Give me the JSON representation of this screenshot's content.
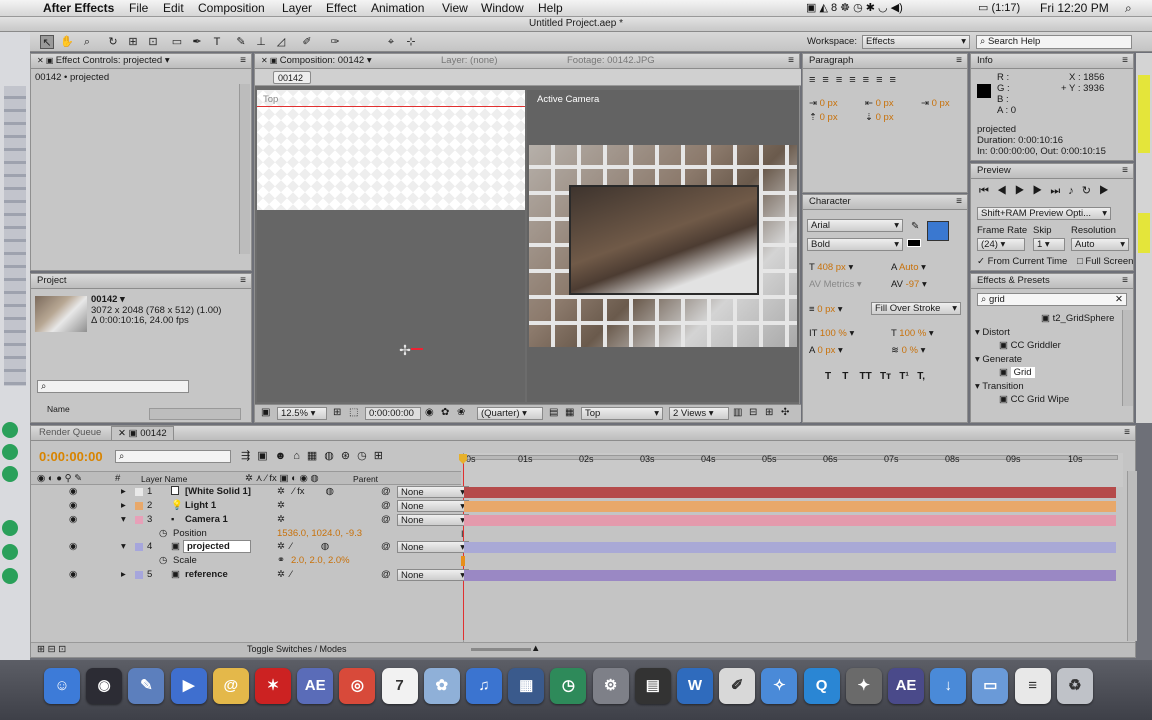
{
  "menubar": {
    "app": "After Effects",
    "items": [
      "File",
      "Edit",
      "Composition",
      "Layer",
      "Effect",
      "Animation",
      "View",
      "Window",
      "Help"
    ],
    "status_items": [
      "8",
      "(1:17)",
      "Fri 12:20 PM"
    ]
  },
  "title": "Untitled Project.aep *",
  "workspace": {
    "label": "Workspace:",
    "value": "Effects"
  },
  "search_help": {
    "placeholder": "Search Help"
  },
  "effect_controls": {
    "tab": "Effect Controls: projected",
    "subtitle": "00142 • projected"
  },
  "composition": {
    "tab": "Composition: 00142",
    "layer_tab": "Layer: (none)",
    "footage_tab": "Footage: 00142.JPG",
    "comp_button": "00142",
    "top_label": "Top",
    "active_camera": "Active Camera",
    "zoom": "12.5%",
    "timecode": "0:00:00:00",
    "resolution": "(Quarter)",
    "view": "Top",
    "views": "2 Views"
  },
  "project": {
    "tab": "Project",
    "name": "00142 ▾",
    "line1": "3072 x 2048  (768 x 512) (1.00)",
    "line2": "Δ 0:00:10:16, 24.00 fps",
    "col_name": "Name"
  },
  "paragraph": {
    "tab": "Paragraph",
    "values": [
      "0 px",
      "0 px",
      "0 px",
      "0 px",
      "0 px"
    ]
  },
  "info": {
    "tab": "Info",
    "r": "R :",
    "g": "G :",
    "b": "B :",
    "a": "A : 0",
    "x": "X : 1856",
    "y": "+ Y : 3936",
    "layer": "projected",
    "duration": "Duration: 0:00:10:16",
    "inout": "In: 0:00:00:00, Out: 0:00:10:15"
  },
  "preview": {
    "tab": "Preview",
    "mode": "Shift+RAM Preview Opti...",
    "frame_rate_label": "Frame Rate",
    "skip_label": "Skip",
    "resolution_label": "Resolution",
    "frame_rate": "(24)",
    "skip": "1",
    "resolution": "Auto",
    "from_current": "From Current Time",
    "full_screen": "Full Screen"
  },
  "character": {
    "tab": "Character",
    "font": "Arial",
    "style": "Bold",
    "size": "408 px",
    "leading": "Auto",
    "kerning": "Metrics",
    "tracking": "-97",
    "stroke": "0 px",
    "stroke_mode": "Fill Over Stroke",
    "vscale": "100 %",
    "hscale": "100 %",
    "baseline": "0 px",
    "tsume": "0 %",
    "styles": [
      "T",
      "T",
      "TT",
      "Tт",
      "T¹",
      "T,"
    ],
    "fill_color": "#3a78d0"
  },
  "effects_presets": {
    "tab": "Effects & Presets",
    "search": "grid",
    "items": [
      {
        "label": "t2_GridSphere",
        "kind": "item"
      },
      {
        "label": "Distort",
        "kind": "group"
      },
      {
        "label": "CC Griddler",
        "kind": "item"
      },
      {
        "label": "Generate",
        "kind": "group"
      },
      {
        "label": "Grid",
        "kind": "selected"
      },
      {
        "label": "Transition",
        "kind": "group"
      },
      {
        "label": "CC Grid Wipe",
        "kind": "item"
      }
    ]
  },
  "timeline": {
    "tabs": [
      "Render Queue",
      "00142"
    ],
    "timecode": "0:00:00:00",
    "col_layer": "Layer Name",
    "col_parent": "Parent",
    "ruler": [
      "0s",
      "01s",
      "02s",
      "03s",
      "04s",
      "05s",
      "06s",
      "07s",
      "08s",
      "09s",
      "10s"
    ],
    "layers": [
      {
        "num": "1",
        "name": "[White Solid 1]",
        "parent": "None",
        "color": "#e9e9e9",
        "bar": "#b54a4a"
      },
      {
        "num": "2",
        "name": "Light 1",
        "parent": "None",
        "color": "#e8a86a",
        "bar": "#e8a86a"
      },
      {
        "num": "3",
        "name": "Camera 1",
        "parent": "None",
        "color": "#e7a0b8",
        "bar": "#e49aac"
      },
      {
        "prop": "Position",
        "value": "1536.0, 1024.0, -9.3"
      },
      {
        "num": "4",
        "name": "projected",
        "parent": "None",
        "color": "#a6a6dc",
        "bar": "#a9a9d6"
      },
      {
        "prop": "Scale",
        "value": "2.0, 2.0, 2.0%"
      },
      {
        "num": "5",
        "name": "reference",
        "parent": "None",
        "color": "#a6a6dc",
        "bar": "#9a88c4"
      }
    ],
    "toggle_label": "Toggle Switches / Modes"
  },
  "dock": {
    "items": [
      {
        "name": "finder-icon",
        "glyph": "☺",
        "color": "#3d7bd8"
      },
      {
        "name": "dashboard-icon",
        "glyph": "◉",
        "color": "#2c2c34"
      },
      {
        "name": "preview-icon",
        "glyph": "✎",
        "color": "#5c7fbd"
      },
      {
        "name": "facetime-icon",
        "glyph": "▶",
        "color": "#3f6fcf"
      },
      {
        "name": "contacts-icon",
        "glyph": "@",
        "color": "#e4b84a"
      },
      {
        "name": "burst-icon",
        "glyph": "✶",
        "color": "#cc2222"
      },
      {
        "name": "after-effects-icon",
        "glyph": "AE",
        "color": "#5a6cb8"
      },
      {
        "name": "chrome-icon",
        "glyph": "◎",
        "color": "#d84a3a"
      },
      {
        "name": "calendar-icon",
        "glyph": "7",
        "color": "#f2f2f2"
      },
      {
        "name": "photo-icon",
        "glyph": "✿",
        "color": "#8fb0d8"
      },
      {
        "name": "itunes-icon",
        "glyph": "♫",
        "color": "#3b74d0"
      },
      {
        "name": "mission-control-icon",
        "glyph": "▦",
        "color": "#3a5a8c"
      },
      {
        "name": "time-machine-icon",
        "glyph": "◷",
        "color": "#2e8a5a"
      },
      {
        "name": "system-prefs-icon",
        "glyph": "⚙",
        "color": "#7e8088"
      },
      {
        "name": "clapper-icon",
        "glyph": "▤",
        "color": "#333"
      },
      {
        "name": "word-icon",
        "glyph": "W",
        "color": "#2f6bbd"
      },
      {
        "name": "script-icon",
        "glyph": "✐",
        "color": "#d8d8d8"
      },
      {
        "name": "safari-icon",
        "glyph": "✧",
        "color": "#4a8ad8"
      },
      {
        "name": "quicktime-icon",
        "glyph": "Q",
        "color": "#2a86d4"
      },
      {
        "name": "photo-booth-icon",
        "glyph": "✦",
        "color": "#6a6a6a"
      },
      {
        "name": "aep-file-icon",
        "glyph": "AE",
        "color": "#4a4a8a"
      },
      {
        "name": "download-icon",
        "glyph": "↓",
        "color": "#4a8ad8"
      },
      {
        "name": "folder-icon",
        "glyph": "▭",
        "color": "#6a9ad8"
      },
      {
        "name": "doc-stack-icon",
        "glyph": "≡",
        "color": "#e8e8e8"
      },
      {
        "name": "trash-icon",
        "glyph": "♻",
        "color": "#bfc2c8"
      }
    ]
  }
}
